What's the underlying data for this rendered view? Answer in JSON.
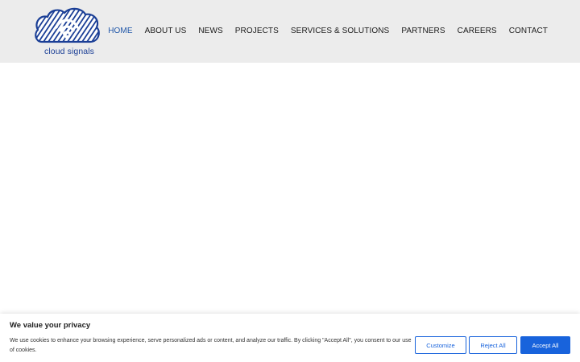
{
  "header": {
    "logo_text": "cloud signals",
    "nav": [
      {
        "label": "HOME",
        "active": true
      },
      {
        "label": "ABOUT US",
        "active": false
      },
      {
        "label": "NEWS",
        "active": false
      },
      {
        "label": "PROJECTS",
        "active": false
      },
      {
        "label": "SERVICES & SOLUTIONS",
        "active": false
      },
      {
        "label": "PARTNERS",
        "active": false
      },
      {
        "label": "CAREERS",
        "active": false
      },
      {
        "label": "CONTACT",
        "active": false
      }
    ]
  },
  "cookie_banner": {
    "title": "We value your privacy",
    "text": "We use cookies to enhance your browsing experience, serve personalized ads or content, and analyze our traffic. By clicking \"Accept All\", you consent to our use of cookies.",
    "customize_label": "Customize",
    "reject_label": "Reject All",
    "accept_label": "Accept All"
  },
  "colors": {
    "brand_blue": "#1b3f96",
    "nav_active": "#1f56a8",
    "button_blue": "#1863dc",
    "header_bg": "#ececec"
  }
}
